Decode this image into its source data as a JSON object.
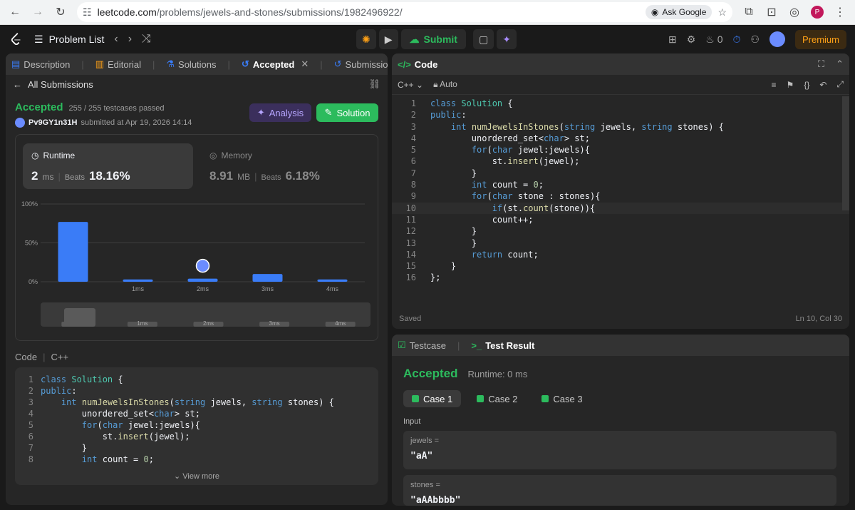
{
  "browser": {
    "url_host": "leetcode.com",
    "url_path": "/problems/jewels-and-stones/submissions/1982496922/",
    "ask_google": "Ask Google",
    "profile_initial": "P"
  },
  "nav": {
    "problem_list": "Problem List",
    "submit": "Submit",
    "streak_count": "0",
    "premium": "Premium"
  },
  "left": {
    "tabs": [
      "Description",
      "Editorial",
      "Solutions",
      "Accepted",
      "Submissions"
    ],
    "all_submissions": "All Submissions",
    "status": "Accepted",
    "testcases": "255 / 255 testcases passed",
    "username": "Pv9GY1n31H",
    "submitted_at": "submitted at Apr 19, 2026 14:14",
    "analysis": "Analysis",
    "solution": "Solution",
    "runtime": {
      "label": "Runtime",
      "value": "2",
      "unit": "ms",
      "beats_label": "Beats",
      "beats": "18.16%"
    },
    "memory": {
      "label": "Memory",
      "value": "8.91",
      "unit": "MB",
      "beats_label": "Beats",
      "beats": "6.18%"
    },
    "code_label": "Code",
    "lang": "C++",
    "view_more": "View more"
  },
  "chart_data": {
    "type": "bar",
    "categories": [
      "",
      "1ms",
      "2ms",
      "3ms",
      "4ms"
    ],
    "values": [
      77,
      3,
      4,
      10,
      3
    ],
    "ylim": [
      0,
      100
    ],
    "yticks": [
      "100%",
      "50%",
      "0%"
    ],
    "highlight_category": "2ms",
    "accent": "#3a7cf7"
  },
  "editor": {
    "title": "Code",
    "lang": "C++",
    "mode": "Auto",
    "saved": "Saved",
    "cursor": "Ln 10, Col 30"
  },
  "code_lines": [
    "class Solution {",
    "public:",
    "    int numJewelsInStones(string jewels, string stones) {",
    "        unordered_set<char> st;",
    "        for(char jewel:jewels){",
    "            st.insert(jewel);",
    "        }",
    "        int count = 0;",
    "        for(char stone : stones){",
    "            if(st.count(stone)){",
    "            count++;",
    "        }",
    "        }",
    "        return count;",
    "    }",
    "};"
  ],
  "test": {
    "tab_testcase": "Testcase",
    "tab_result": "Test Result",
    "status": "Accepted",
    "runtime": "Runtime: 0 ms",
    "cases": [
      "Case 1",
      "Case 2",
      "Case 3"
    ],
    "input_label": "Input",
    "inputs": [
      {
        "name": "jewels =",
        "value": "\"aA\""
      },
      {
        "name": "stones =",
        "value": "\"aAAbbbb\""
      }
    ]
  },
  "colors": {
    "accepted": "#2cbb5d",
    "bar": "#3a7cf7",
    "premium": "#ffa116"
  }
}
